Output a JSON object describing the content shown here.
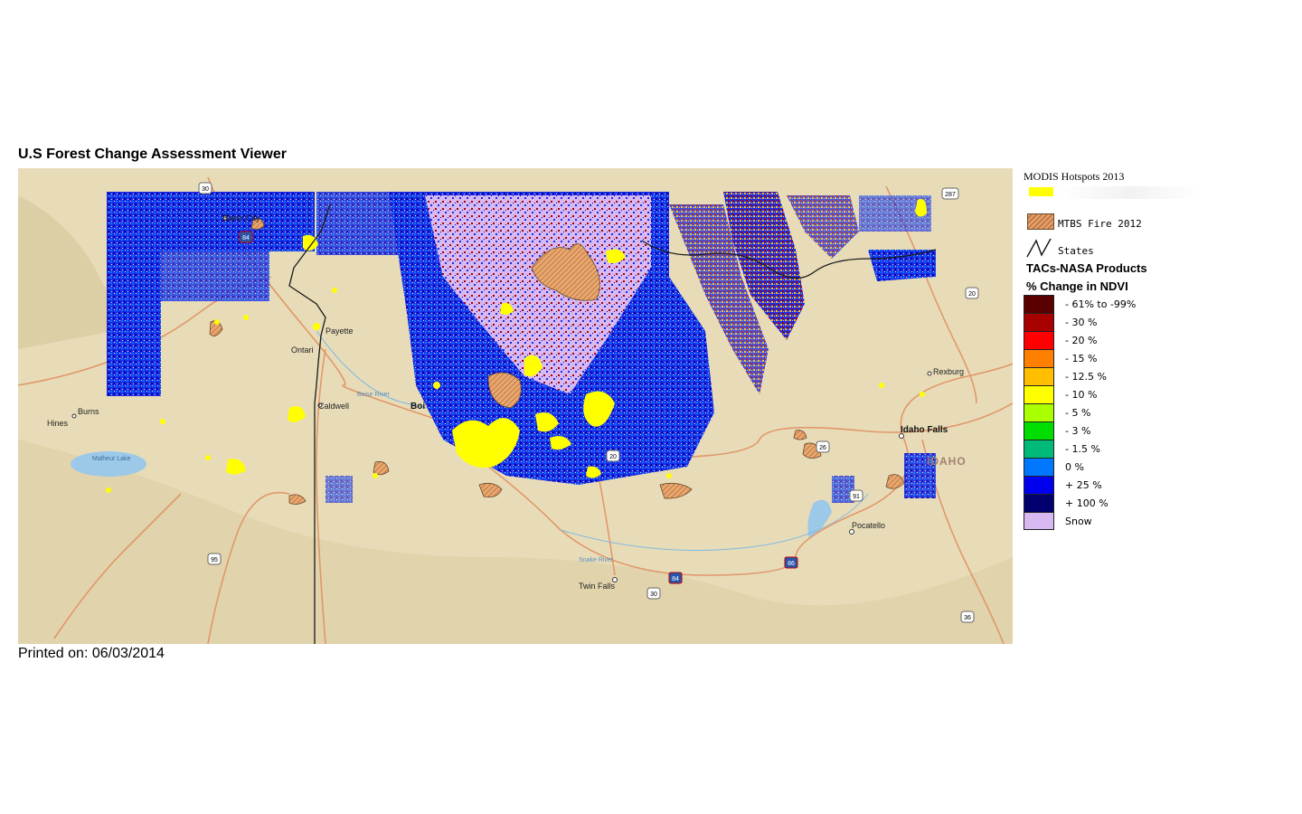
{
  "page": {
    "title": "U.S Forest Change Assessment Viewer",
    "printed": "Printed on: 06/03/2014"
  },
  "map": {
    "base_color": "#e8dcb8",
    "places": {
      "baker_city": "Baker City",
      "payette": "Payette",
      "ontario": "Ontari",
      "caldwell": "Caldwell",
      "boise": "Boi",
      "burns": "Burns",
      "hines": "Hines",
      "malheur_lake": "Malheur\nLake",
      "idaho_falls": "Idaho Falls",
      "rexburg": "Rexburg",
      "pocatello": "Pocatello",
      "twin_falls": "Twin Falls",
      "idaho": "IDAHO",
      "boise_river": "Boise River",
      "snake_river": "Snake River"
    },
    "shields": {
      "s30": "30",
      "s84a": "84",
      "s287": "287",
      "s20a": "20",
      "s26": "26",
      "s20b": "20",
      "s91": "91",
      "s95": "95",
      "s86": "86",
      "s84b": "84",
      "s30b": "30",
      "s36": "36"
    }
  },
  "legend": {
    "modis_title": "MODIS Hotspots  2013",
    "modis_color": "#ffff00",
    "mtbs_label": "MTBS Fire 2012",
    "states_label": "States",
    "products_title": "TACs-NASA Products",
    "ndvi_title": "% Change in NDVI",
    "classes": [
      {
        "label": "- 61% to -99%",
        "color": "#5a0000"
      },
      {
        "label": "- 30 %",
        "color": "#a80000"
      },
      {
        "label": "- 20 %",
        "color": "#ff0000"
      },
      {
        "label": "- 15 %",
        "color": "#ff7f00"
      },
      {
        "label": "- 12.5 %",
        "color": "#ffbf00"
      },
      {
        "label": "- 10 %",
        "color": "#ffff00"
      },
      {
        "label": "- 5 %",
        "color": "#aaff00"
      },
      {
        "label": "- 3 %",
        "color": "#00dd00"
      },
      {
        "label": "- 1.5 %",
        "color": "#00bb77"
      },
      {
        "label": "0 %",
        "color": "#0077ff"
      },
      {
        "label": "+ 25 %",
        "color": "#0000ee"
      },
      {
        "label": "+ 100 %",
        "color": "#00006e"
      },
      {
        "label": "Snow",
        "color": "#d8b8f0"
      }
    ]
  }
}
